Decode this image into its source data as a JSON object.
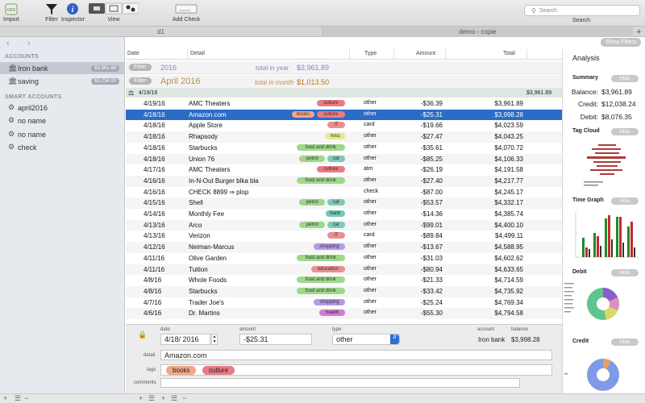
{
  "toolbar": {
    "import": "Import",
    "filter": "Filter",
    "inspector": "Inspector",
    "view": "View",
    "add_check": "Add Check",
    "search_placeholder": "Search",
    "search_label": "Search"
  },
  "tabs": [
    "d1",
    "demo - copie"
  ],
  "show_filters": "Show Filters",
  "sidebar": {
    "accounts_heading": "ACCOUNTS",
    "accounts": [
      {
        "name": "Iron bank",
        "balance": "$3,961.89"
      },
      {
        "name": "saving",
        "balance": "$5,234.00"
      }
    ],
    "smart_heading": "SMART ACCOUNTS",
    "smart": [
      "april2016",
      "no name",
      "no name",
      "check"
    ]
  },
  "table": {
    "headers": {
      "date": "Date",
      "detail": "Detail",
      "type": "Type",
      "amount": "Amount",
      "total": "Total"
    },
    "year_filter": {
      "pill": "Filter",
      "period": "2016",
      "label": "total in year",
      "value": "$3,961.89"
    },
    "month_filter": {
      "pill": "Filter",
      "period": "April 2016",
      "label": "total in month",
      "value": "$1,013.50"
    },
    "group": {
      "date": "4/19/16",
      "total": "$3,961.89"
    },
    "rows": [
      {
        "date": "4/19/16",
        "detail": "AMC Theaters",
        "tags": [
          "culture"
        ],
        "type": "other",
        "amount": "-$36.39",
        "total": "$3,961.89"
      },
      {
        "date": "4/18/16",
        "detail": "Amazon.com",
        "tags": [
          "books",
          "culture"
        ],
        "type": "other",
        "amount": "-$25.31",
        "total": "$3,998.28"
      },
      {
        "date": "4/18/16",
        "detail": "Apple Store",
        "tags": [
          "IT"
        ],
        "type": "card",
        "amount": "-$19.66",
        "total": "$4,023.59"
      },
      {
        "date": "4/18/16",
        "detail": "Rhapsody",
        "tags": [
          "misc"
        ],
        "type": "other",
        "amount": "-$27.47",
        "total": "$4,043.25"
      },
      {
        "date": "4/18/16",
        "detail": "Starbucks",
        "tags": [
          "food and drink"
        ],
        "type": "other",
        "amount": "-$35.61",
        "total": "$4,070.72"
      },
      {
        "date": "4/18/16",
        "detail": "Union 76",
        "tags": [
          "petrol",
          "car"
        ],
        "type": "other",
        "amount": "-$85.25",
        "total": "$4,106.33"
      },
      {
        "date": "4/17/16",
        "detail": "AMC Theaters",
        "tags": [
          "culture"
        ],
        "type": "atm",
        "amount": "-$26.19",
        "total": "$4,191.58"
      },
      {
        "date": "4/16/16",
        "detail": "In-N-Out Burger blka bla",
        "tags": [
          "food and drink"
        ],
        "type": "other",
        "amount": "-$27.40",
        "total": "$4,217.77"
      },
      {
        "date": "4/16/16",
        "detail": "CHECK 8899 ⇒ plop",
        "tags": [],
        "type": "check",
        "amount": "-$87.00",
        "total": "$4,245.17"
      },
      {
        "date": "4/15/16",
        "detail": "Shell",
        "tags": [
          "petrol",
          "car"
        ],
        "type": "other",
        "amount": "-$53.57",
        "total": "$4,332.17"
      },
      {
        "date": "4/14/16",
        "detail": "Monthly Fee",
        "tags": [
          "bank"
        ],
        "type": "other",
        "amount": "-$14.36",
        "total": "$4,385.74"
      },
      {
        "date": "4/13/16",
        "detail": "Arco",
        "tags": [
          "petrol",
          "car"
        ],
        "type": "other",
        "amount": "-$99.01",
        "total": "$4,400.10"
      },
      {
        "date": "4/13/16",
        "detail": "Verizon",
        "tags": [
          "IT"
        ],
        "type": "card",
        "amount": "-$89.84",
        "total": "$4,499.11"
      },
      {
        "date": "4/12/16",
        "detail": "Neiman-Marcus",
        "tags": [
          "shopping"
        ],
        "type": "other",
        "amount": "-$13.67",
        "total": "$4,588.95"
      },
      {
        "date": "4/11/16",
        "detail": "Olive Garden",
        "tags": [
          "food and drink"
        ],
        "type": "other",
        "amount": "-$31.03",
        "total": "$4,602.62"
      },
      {
        "date": "4/11/16",
        "detail": "Tuition",
        "tags": [
          "education"
        ],
        "type": "other",
        "amount": "-$80.94",
        "total": "$4,633.65"
      },
      {
        "date": "4/8/16",
        "detail": "Whole Foods",
        "tags": [
          "food and drink"
        ],
        "type": "other",
        "amount": "-$21.33",
        "total": "$4,714.59"
      },
      {
        "date": "4/8/16",
        "detail": "Starbucks",
        "tags": [
          "food and drink"
        ],
        "type": "other",
        "amount": "-$33.42",
        "total": "$4,735.92"
      },
      {
        "date": "4/7/16",
        "detail": "Trader Joe's",
        "tags": [
          "shopping"
        ],
        "type": "other",
        "amount": "-$25.24",
        "total": "$4,769.34"
      },
      {
        "date": "4/6/16",
        "detail": "Dr. Martins",
        "tags": [
          "health"
        ],
        "type": "other",
        "amount": "-$55.30",
        "total": "$4,794.58"
      }
    ]
  },
  "tag_colors": {
    "culture": "#e87b86",
    "books": "#f2a68a",
    "IT": "#ee8f8f",
    "misc": "#e3ea88",
    "food and drink": "#9ed88a",
    "petrol": "#9ed88a",
    "car": "#7fc9b6",
    "bank": "#6fcab5",
    "shopping": "#b69be6",
    "education": "#e99090",
    "health": "#d27ad4"
  },
  "editor": {
    "date_label": "date",
    "date_value": "4/18/ 2016",
    "amount_label": "amount",
    "amount_value": "-$25.31",
    "type_label": "type",
    "type_value": "other",
    "account_label": "account",
    "account_value": "Iron bank",
    "balance_label": "balance",
    "balance_value": "$3,998.28",
    "detail_label": "detail",
    "detail_value": "Amazon.com",
    "tags_label": "tags",
    "tags": [
      "books",
      "culture"
    ],
    "comments_label": "comments",
    "comments_value": ""
  },
  "panel": {
    "title": "Analysis",
    "summary": "Summary",
    "hide": "Hide",
    "balance_label": "Balance:",
    "balance": "$3,961.89",
    "credit_label": "Credit:",
    "credit": "$12,038.24",
    "debit_label": "Debit:",
    "debit": "$8,076.35",
    "tag_cloud": "Tag Cloud",
    "time_graph": "Time Graph",
    "debit_chart": "Debit",
    "credit_chart": "Credit"
  },
  "footer": {
    "add": "+",
    "remove": "−"
  }
}
